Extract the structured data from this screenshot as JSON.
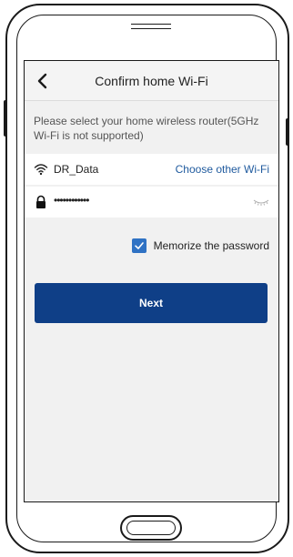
{
  "header": {
    "title": "Confirm home Wi-Fi",
    "back_icon": "chevron-left-icon"
  },
  "hint": {
    "text": "Please select your home wireless router(5GHz Wi-Fi is not supported)"
  },
  "wifi": {
    "icon": "wifi-icon",
    "ssid": "DR_Data",
    "choose_label": "Choose other Wi-Fi"
  },
  "password": {
    "icon": "lock-icon",
    "masked_value": "••••••••••••",
    "visibility_icon": "eye-closed-icon"
  },
  "memorize": {
    "checked": true,
    "label": "Memorize the password"
  },
  "actions": {
    "next_label": "Next"
  },
  "colors": {
    "primary_button": "#0f3f87",
    "link": "#1f5a9e",
    "checkbox": "#2f72c4",
    "screen_background": "#f1f1f1"
  }
}
